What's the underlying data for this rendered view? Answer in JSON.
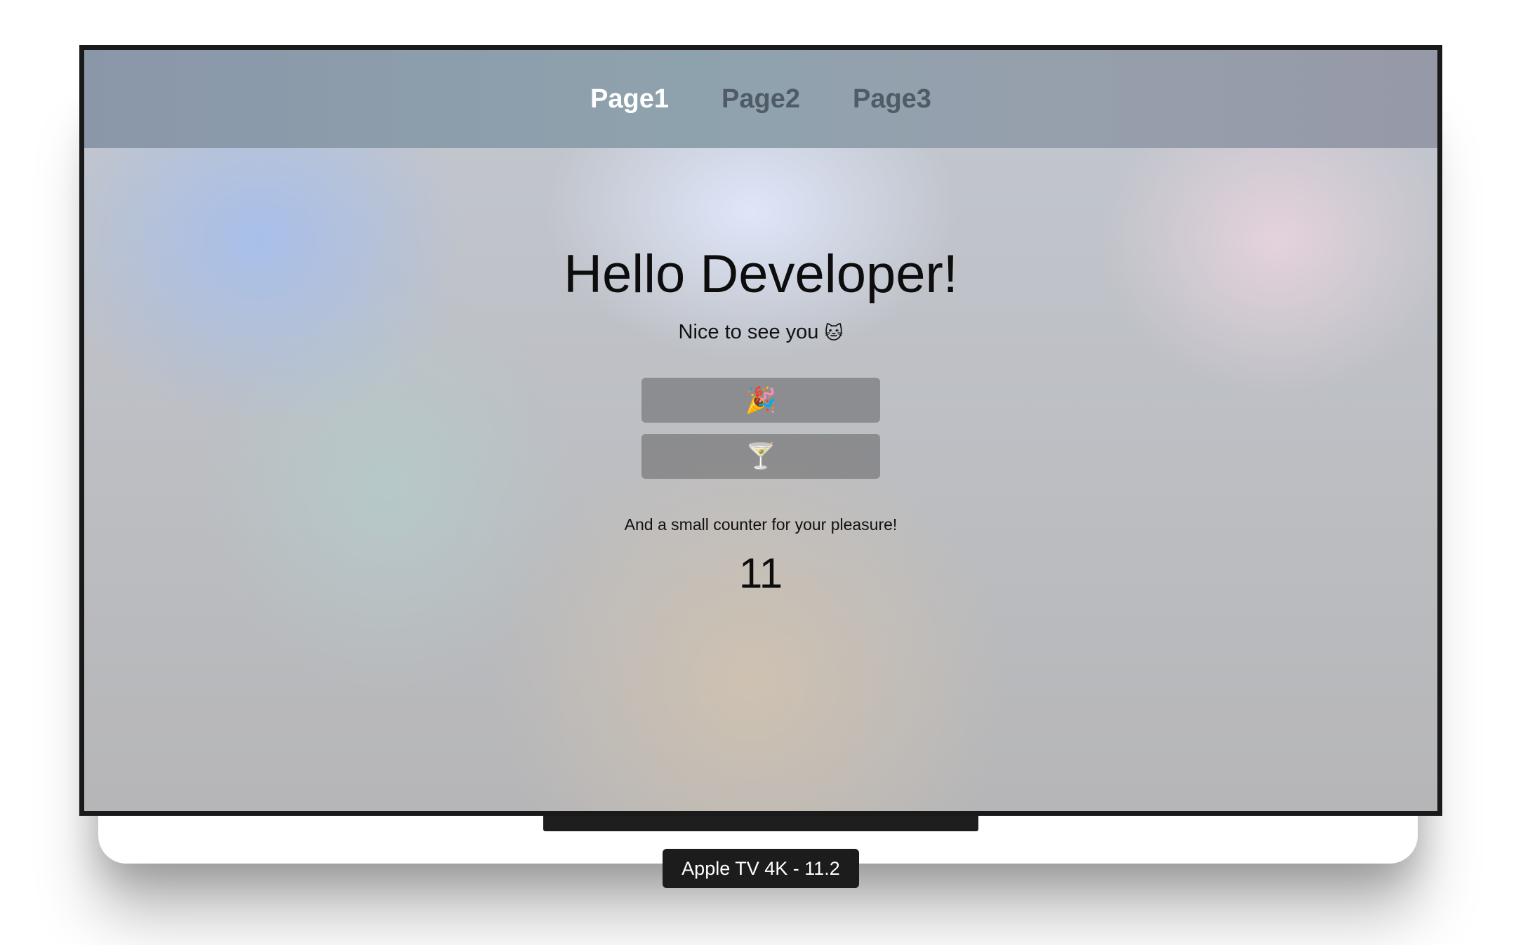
{
  "app": {
    "device_label": "Apple TV 4K - 11.2"
  },
  "nav": {
    "tabs": [
      {
        "label": "Page1",
        "active": true
      },
      {
        "label": "Page2",
        "active": false
      },
      {
        "label": "Page3",
        "active": false
      }
    ]
  },
  "main": {
    "headline": "Hello Developer!",
    "subtitle": "Nice to see you",
    "subtitle_icon": "cat-face-icon",
    "buttons": [
      {
        "icon": "party-popper-icon",
        "glyph": "🎉"
      },
      {
        "icon": "cocktail-glass-icon",
        "glyph": "🍸"
      }
    ],
    "counter_caption": "And a small counter for your pleasure!",
    "counter_value": "11"
  },
  "colors": {
    "nav_active": "#ffffff",
    "nav_inactive": "#4f5b66",
    "frame": "#1a1a1a",
    "button_bg": "#6e6e70"
  }
}
